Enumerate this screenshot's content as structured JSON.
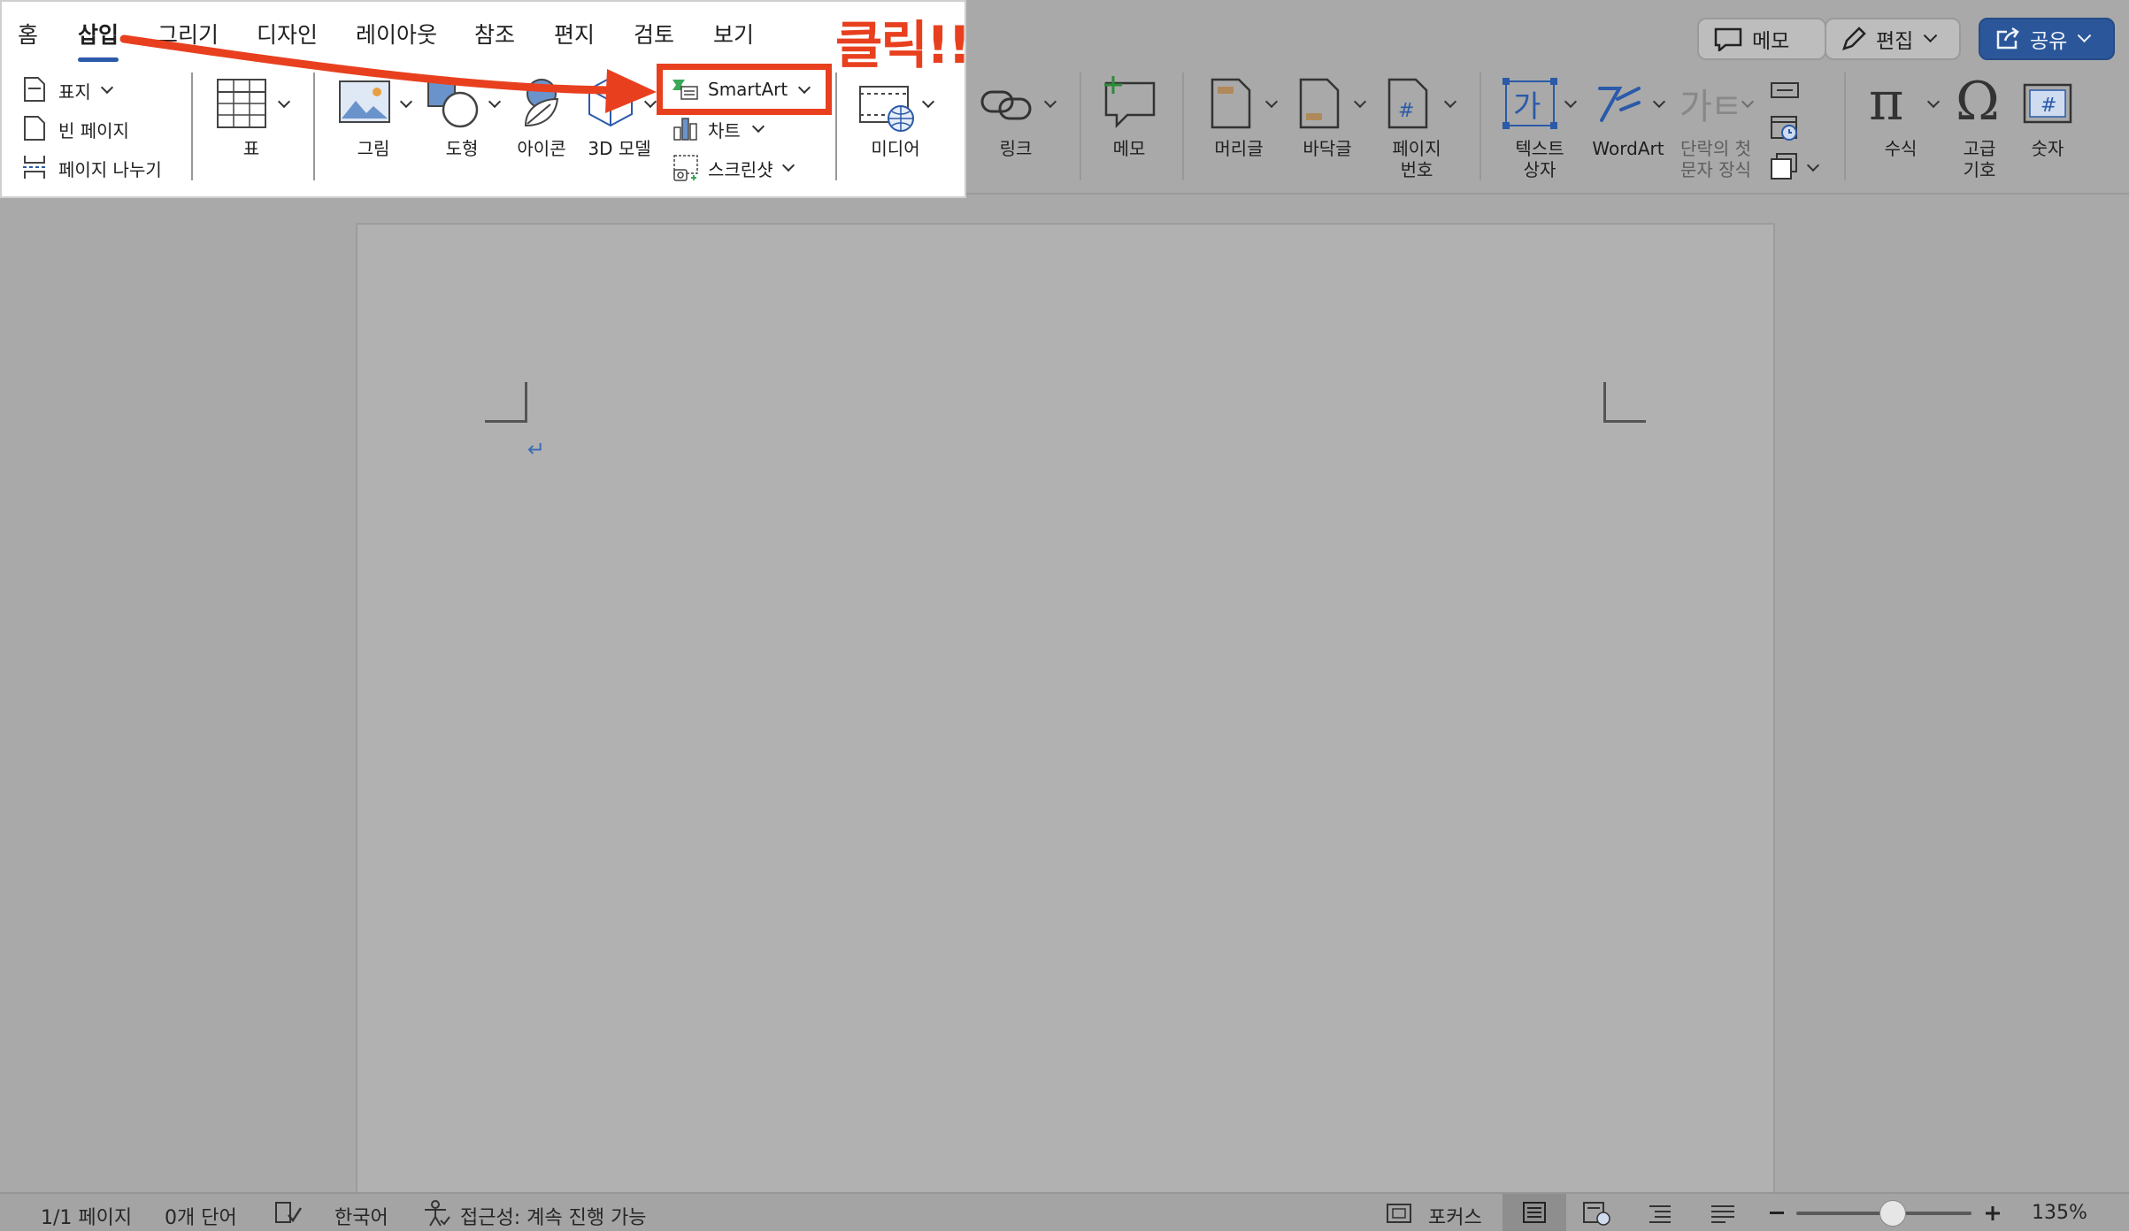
{
  "tabs": [
    "홈",
    "삽입",
    "그리기",
    "디자인",
    "레이아웃",
    "참조",
    "편지",
    "검토",
    "보기"
  ],
  "annotation": {
    "click_label": "클릭!!"
  },
  "pages_group": {
    "cover": "표지",
    "blank": "빈 페이지",
    "page_break": "페이지 나누기"
  },
  "table": {
    "label": "표"
  },
  "illustrations": {
    "picture": "그림",
    "shapes": "도형",
    "icons": "아이콘",
    "model3d": "3D 모델",
    "smartart": "SmartArt",
    "chart": "차트",
    "screenshot": "스크린샷"
  },
  "media": {
    "label": "미디어"
  },
  "links": {
    "label": "링크"
  },
  "comment": {
    "label": "메모"
  },
  "header_footer": {
    "header": "머리글",
    "footer": "바닥글",
    "page_number_1": "페이지",
    "page_number_2": "번호"
  },
  "text": {
    "textbox_1": "텍스트",
    "textbox_2": "상자",
    "wordart": "WordArt",
    "dropcap_1": "단락의 첫",
    "dropcap_2": "문자 장식",
    "textbox_glyph": "가",
    "dropcap_glyph": "가ㅌ"
  },
  "symbols": {
    "equation": "수식",
    "symbol_1": "고급",
    "symbol_2": "기호",
    "number": "숫자"
  },
  "top_right": {
    "comments": "메모",
    "editing": "편집",
    "share": "공유"
  },
  "status": {
    "page": "1/1 페이지",
    "words": "0개 단어",
    "language": "한국어",
    "accessibility": "접근성: 계속 진행 가능",
    "focus": "포커스",
    "zoom": "135%",
    "zoom_level": 0.55
  },
  "colors": {
    "accent": "#2b5aa8",
    "annotation_red": "#e8401f",
    "ribbon_bg": "#ffffff",
    "dim_bg": "#a9a9a9"
  }
}
